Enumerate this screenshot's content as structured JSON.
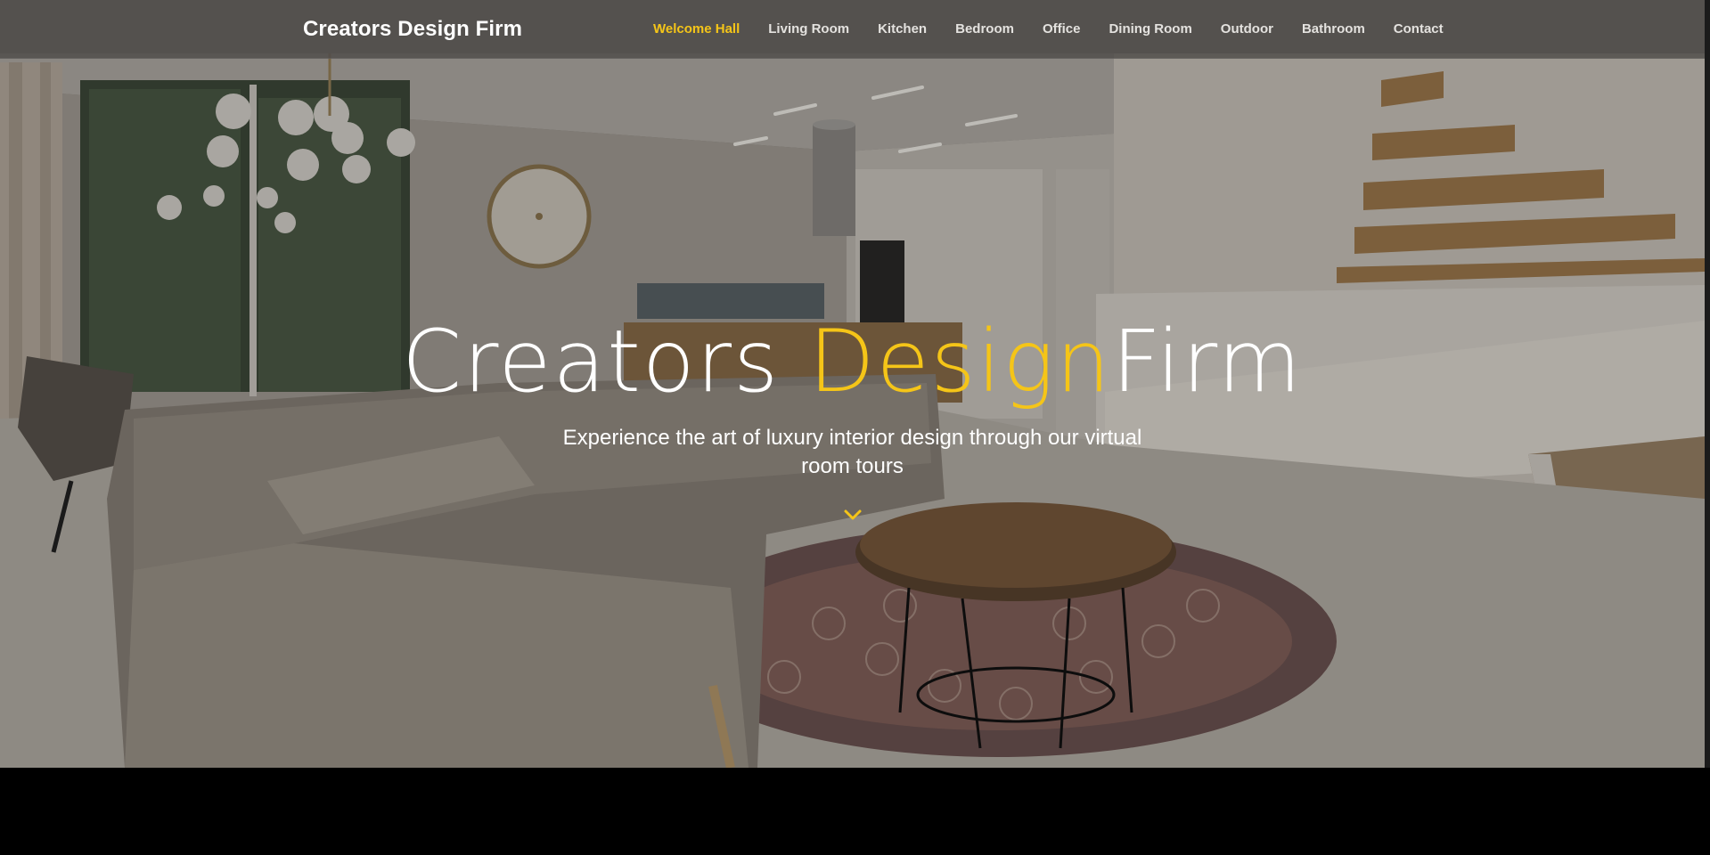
{
  "brand": {
    "name": "Creators Design Firm"
  },
  "nav": {
    "items": [
      {
        "label": "Welcome Hall",
        "active": true
      },
      {
        "label": "Living Room",
        "active": false
      },
      {
        "label": "Kitchen",
        "active": false
      },
      {
        "label": "Bedroom",
        "active": false
      },
      {
        "label": "Office",
        "active": false
      },
      {
        "label": "Dining Room",
        "active": false
      },
      {
        "label": "Outdoor",
        "active": false
      },
      {
        "label": "Bathroom",
        "active": false
      },
      {
        "label": "Contact",
        "active": false
      }
    ]
  },
  "hero": {
    "title_part1": "Creators ",
    "title_accent": "Design",
    "title_part2": "Firm",
    "subtitle": "Experience the art of luxury interior design through our virtual room tours",
    "scroll_icon": "chevron-down-icon"
  },
  "colors": {
    "accent": "#f5c518",
    "text": "#ffffff",
    "navbar_bg": "#4e4c49",
    "footer_band": "#000000"
  }
}
